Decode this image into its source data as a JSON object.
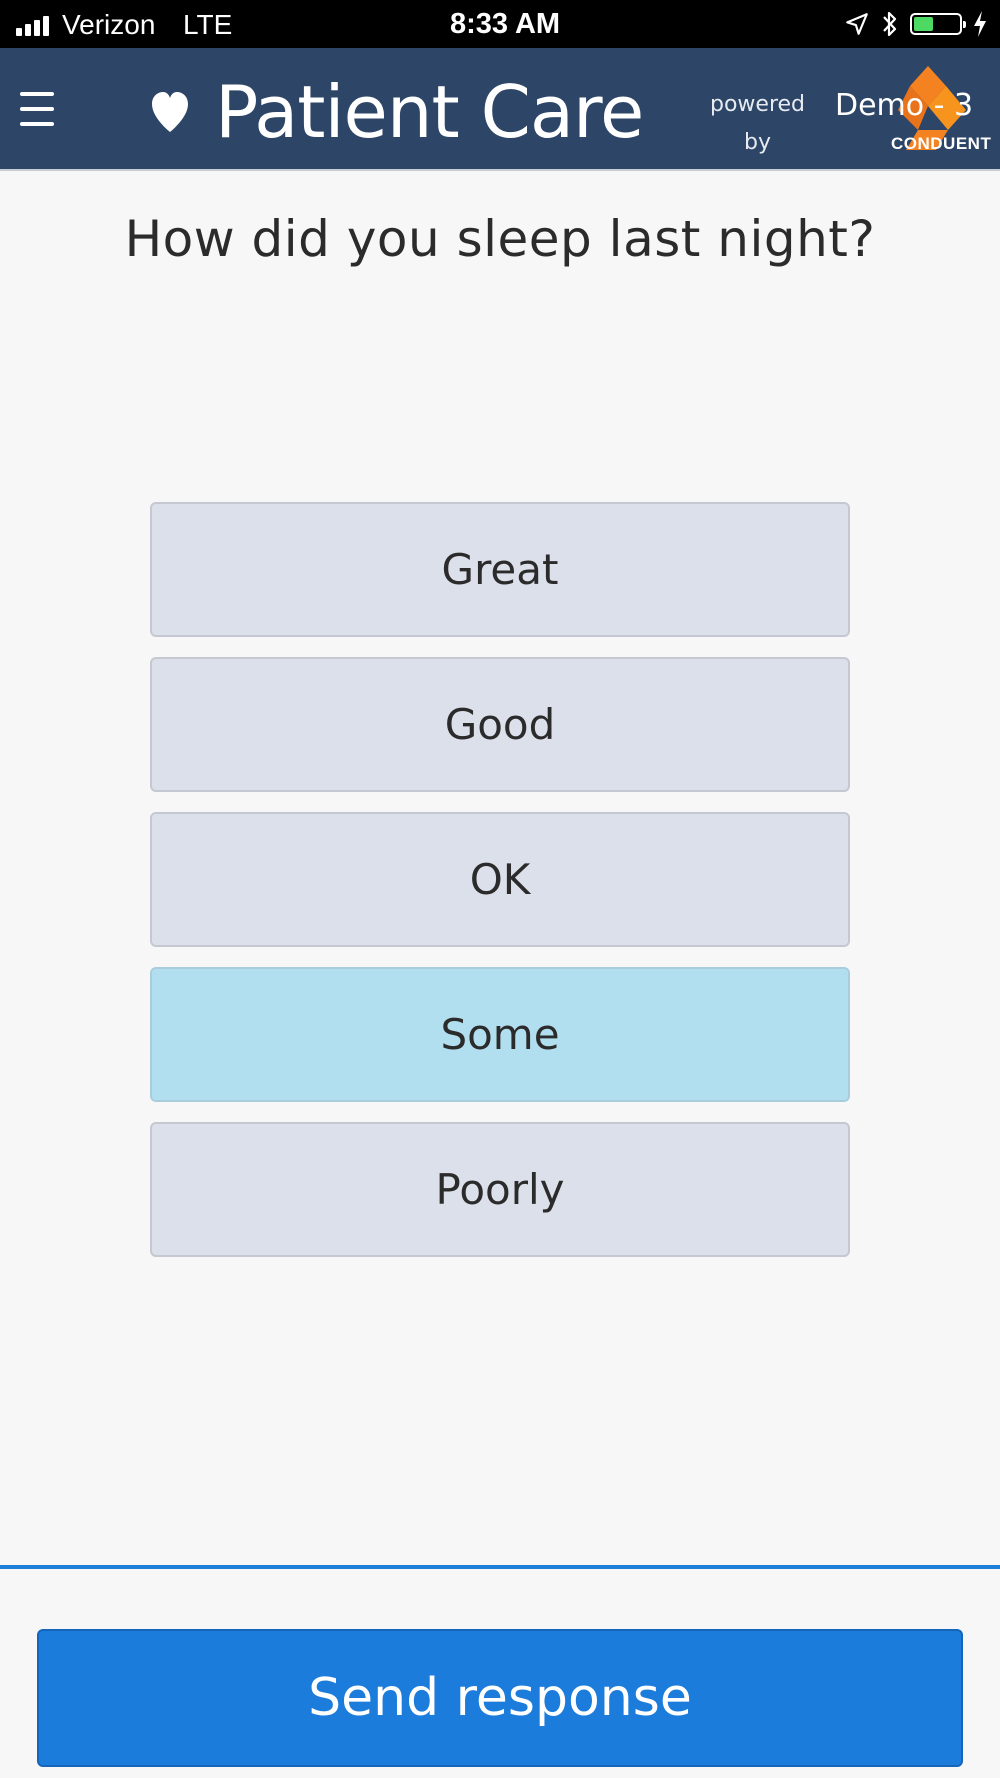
{
  "status_bar": {
    "carrier": "Verizon",
    "network": "LTE",
    "time": "8:33 AM",
    "battery_level": 0.45,
    "icons": [
      "signal-bars-icon",
      "location-arrow-icon",
      "bluetooth-icon",
      "battery-icon",
      "charging-bolt-icon"
    ]
  },
  "header": {
    "title": "Patient Care",
    "powered_by_line1": "powered",
    "powered_by_line2": "by",
    "demo_label": "Demo - 3",
    "logo_text": "CONDUENT",
    "colors": {
      "background": "#2d4566",
      "logo_orange": "#f58220"
    }
  },
  "survey": {
    "question": "How did you sleep last night?",
    "options": [
      {
        "label": "Great",
        "selected": false
      },
      {
        "label": "Good",
        "selected": false
      },
      {
        "label": "OK",
        "selected": false
      },
      {
        "label": "Some",
        "selected": true
      },
      {
        "label": "Poorly",
        "selected": false
      }
    ],
    "colors": {
      "option_default": "#dce0ea",
      "option_selected": "#b2dfef"
    }
  },
  "footer": {
    "send_label": "Send response",
    "accent": "#1b7cdb"
  }
}
